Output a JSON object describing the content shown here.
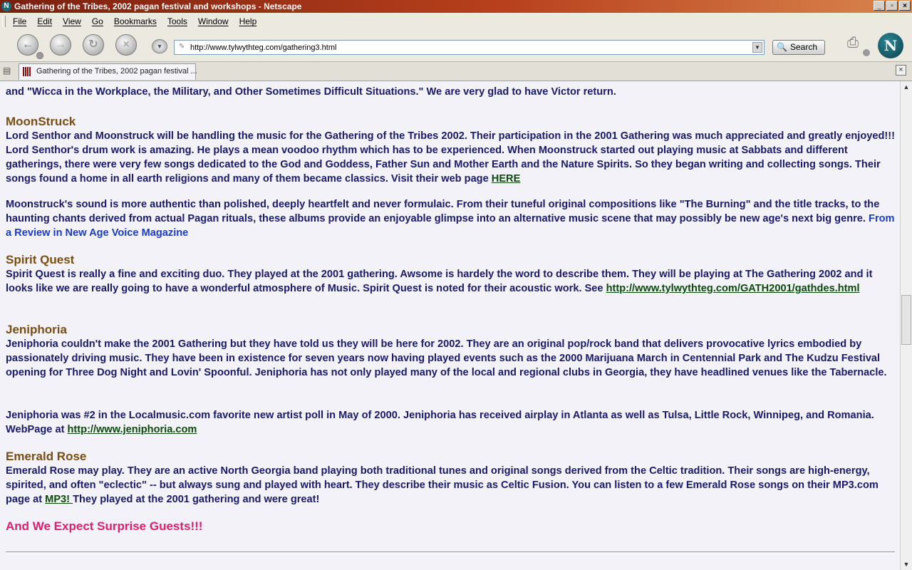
{
  "window": {
    "title": "Gathering of the Tribes, 2002 pagan festival and workshops - Netscape",
    "buttons": [
      "_",
      "▫",
      "×"
    ]
  },
  "menu": [
    "File",
    "Edit",
    "View",
    "Go",
    "Bookmarks",
    "Tools",
    "Window",
    "Help"
  ],
  "toolbar": {
    "url": "http://www.tylwythteg.com/gathering3.html",
    "search_label": "Search"
  },
  "tab": {
    "label": "Gathering of the Tribes, 2002 pagan festival ..."
  },
  "content": {
    "top_line": "and \"Wicca in the Workplace, the Military, and Other Sometimes Difficult Situations.\"  We are very glad to have Victor return.",
    "moonstruck": {
      "heading": "MoonStruck",
      "p1": "Lord Senthor and Moonstruck will be handling the music for the Gathering of the Tribes 2002.  Their participation in the 2001 Gathering was much appreciated and greatly enjoyed!!!  Lord Senthor's drum work is amazing.  He plays a mean voodoo rhythm which has to be experienced.   When Moonstruck started out playing music at Sabbats and different gatherings, there were very few songs dedicated to the God and Goddess, Father Sun and Mother Earth and the Nature Spirits. So they began writing and collecting songs. Their songs found a home in all earth religions and many of them became classics. Visit their web page ",
      "p1_link": "HERE",
      "p2": "Moonstruck's sound is more authentic than polished, deeply heartfelt and never formulaic. From their tuneful original compositions like \"The Burning\" and the title tracks, to the haunting chants derived from actual Pagan rituals, these albums provide an enjoyable glimpse into an alternative music scene that may possibly be new age's next big genre.  ",
      "p2_source": "From a Review in New Age Voice Magazine"
    },
    "spirit_quest": {
      "heading": "Spirit Quest",
      "p1": "Spirit Quest is really a fine and exciting duo.   They played at the 2001 gathering.  Awsome is hardely the word to describe them.  They will be playing at The Gathering 2002 and it looks like we are really going to have a wonderful atmosphere of Music.  Spirit Quest is noted for their acoustic work.  See ",
      "link": "http://www.tylwythteg.com/GATH2001/gathdes.html"
    },
    "jeniphoria": {
      "heading": "Jeniphoria",
      "p1": "Jeniphoria couldn't make the 2001 Gathering but they have told us they will be here for 2002.  They are an original pop/rock band that delivers provocative lyrics embodied by passionately driving music. They have been in existence for seven years now having played events such as the 2000 Marijuana March in Centennial Park and The Kudzu Festival opening for Three Dog Night and Lovin' Spoonful. Jeniphoria has not only played many of the local and regional clubs in Georgia, they have headlined venues like the Tabernacle.",
      "p2": "Jeniphoria was #2 in the Localmusic.com favorite new artist poll in May of 2000. Jeniphoria has received airplay in Atlanta as well as Tulsa, Little Rock, Winnipeg, and Romania.  WebPage at ",
      "link": "http://www.jeniphoria.com"
    },
    "emerald_rose": {
      "heading": "Emerald Rose",
      "p1": "Emerald Rose may play.  They are an active North Georgia band playing both traditional tunes and original songs derived from the Celtic tradition. Their songs are high-energy, spirited, and often \"eclectic\" -- but always sung and played with heart. They describe their music as Celtic Fusion.  You can listen to a few Emerald Rose songs on their  MP3.com page at ",
      "link": "MP3! ",
      "p1_end": "  They played at the 2001 gathering and were great!"
    },
    "surprise": "And We Expect Surprise Guests!!!"
  },
  "colors": {
    "body_text": "#1a1a6e",
    "heading": "#7a4e10",
    "link": "#0c4a0c",
    "review": "#1c3cc8",
    "surprise": "#e0206e"
  }
}
